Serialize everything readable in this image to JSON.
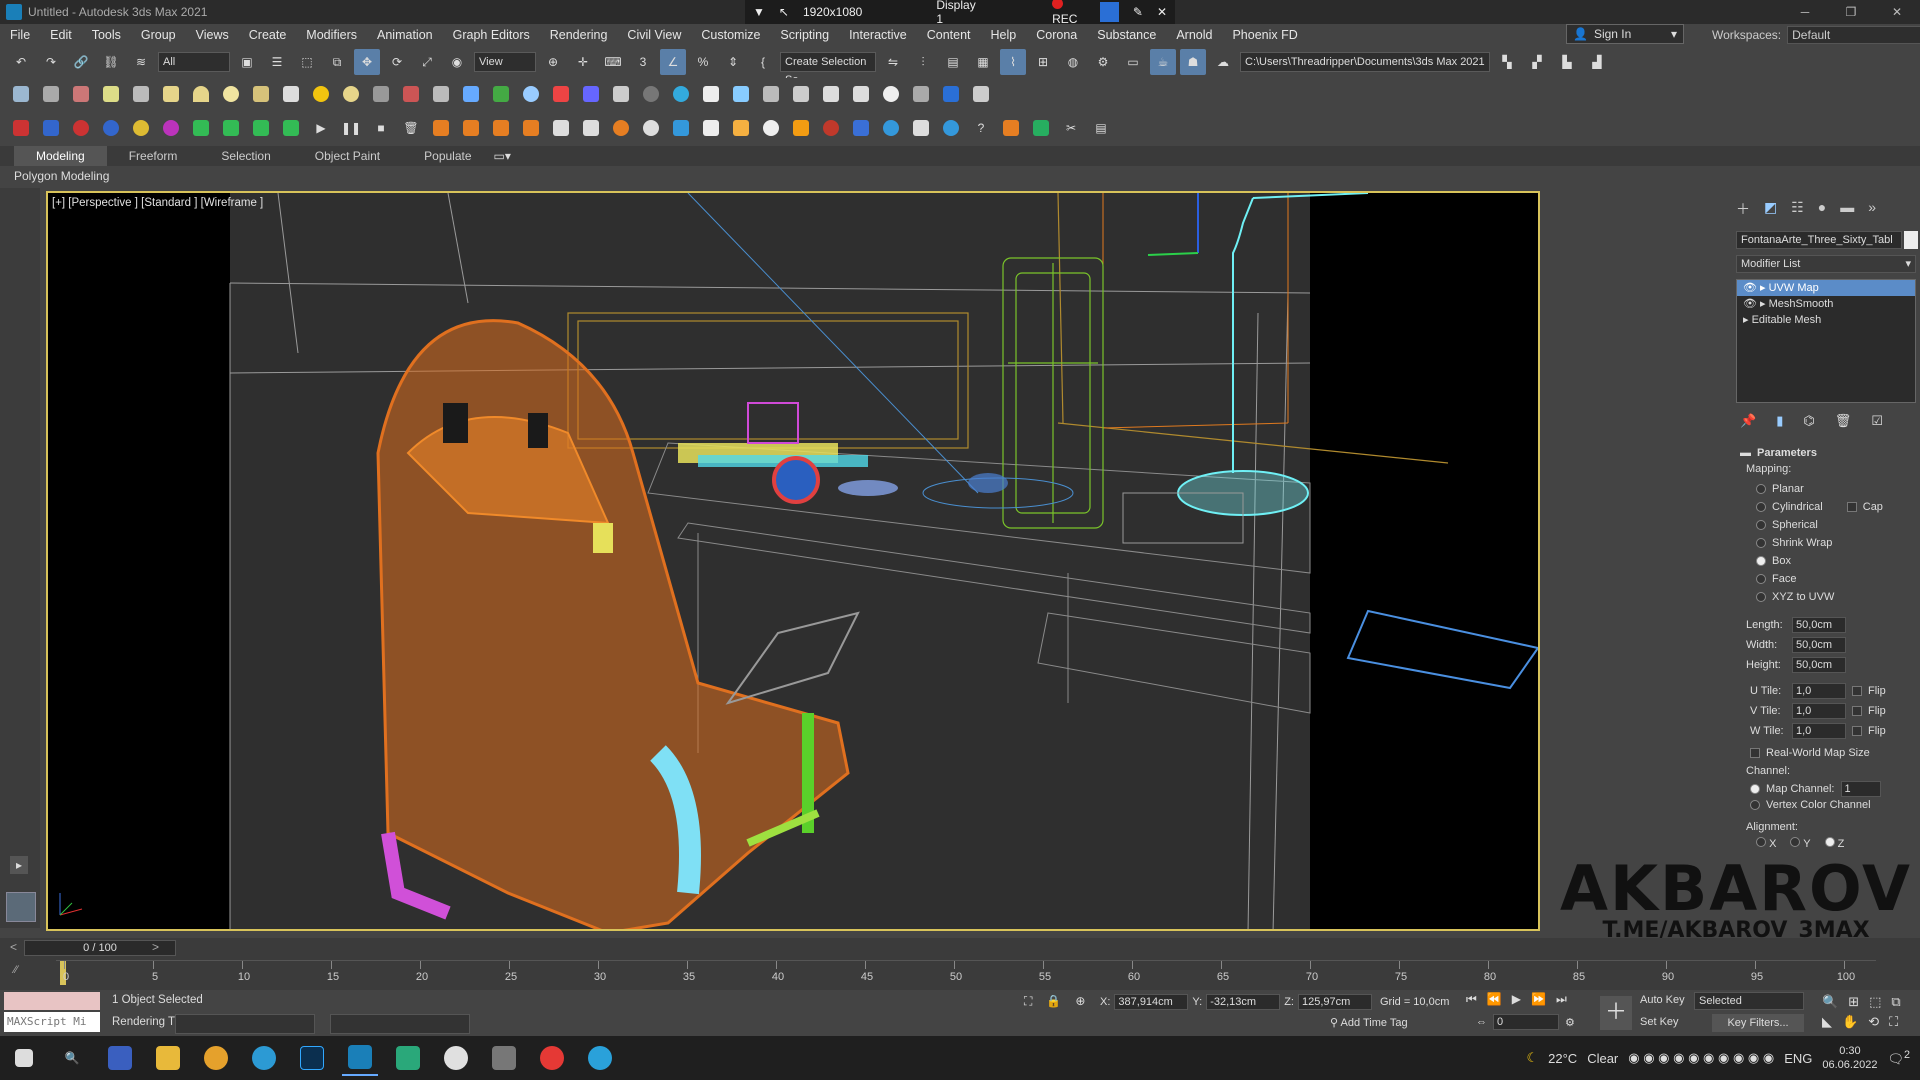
{
  "window": {
    "title": "Untitled - Autodesk 3ds Max 2021"
  },
  "recorder": {
    "resolution": "1920x1080",
    "display": "Display 1",
    "rec_label": "REC"
  },
  "menu": [
    "File",
    "Edit",
    "Tools",
    "Group",
    "Views",
    "Create",
    "Modifiers",
    "Animation",
    "Graph Editors",
    "Rendering",
    "Civil View",
    "Customize",
    "Scripting",
    "Interactive",
    "Content",
    "Help",
    "Corona",
    "Substance",
    "Arnold",
    "Phoenix FD"
  ],
  "account": {
    "sign_in": "Sign In",
    "workspaces_label": "Workspaces:",
    "workspace": "Default"
  },
  "toolbar": {
    "filter": "All",
    "refcoord": "View",
    "selection_set": "Create Selection Se",
    "project_path": "C:\\Users\\Threadripper\\Documents\\3ds Max 2021"
  },
  "ribbon": {
    "tabs": [
      "Modeling",
      "Freeform",
      "Selection",
      "Object Paint",
      "Populate"
    ],
    "sub": "Polygon Modeling"
  },
  "viewport": {
    "label": "[+] [Perspective ] [Standard ] [Wireframe ]"
  },
  "panel": {
    "object_name": "FontanaArte_Three_Sixty_Tabl",
    "modifier_list": "Modifier List",
    "stack": [
      "UVW Map",
      "MeshSmooth",
      "Editable Mesh"
    ],
    "parameters": "Parameters",
    "mapping": "Mapping:",
    "mapping_types": [
      "Planar",
      "Cylindrical",
      "Spherical",
      "Shrink Wrap",
      "Box",
      "Face",
      "XYZ to UVW"
    ],
    "cap": "Cap",
    "length_label": "Length:",
    "length": "50,0cm",
    "width_label": "Width:",
    "width": "50,0cm",
    "height_label": "Height:",
    "height": "50,0cm",
    "utile_label": "U Tile:",
    "utile": "1,0",
    "vtile_label": "V Tile:",
    "vtile": "1,0",
    "wtile_label": "W Tile:",
    "wtile": "1,0",
    "flip": "Flip",
    "real_world": "Real-World Map Size",
    "channel": "Channel:",
    "map_channel": "Map Channel:",
    "map_channel_value": "1",
    "vertex_color": "Vertex Color Channel",
    "alignment": "Alignment:",
    "axes": [
      "X",
      "Y",
      "Z"
    ]
  },
  "watermark": {
    "name": "AKBAROV",
    "link": "T.ME/AKBAROV_3MAX"
  },
  "timeline": {
    "frame": "0 / 100",
    "ticks": [
      "0",
      "5",
      "10",
      "15",
      "20",
      "25",
      "30",
      "35",
      "40",
      "45",
      "50",
      "55",
      "60",
      "65",
      "70",
      "75",
      "80",
      "85",
      "90",
      "95",
      "100"
    ]
  },
  "status": {
    "selected": "1 Object Selected",
    "maxscript": "MAXScript Mi",
    "rendering": "Rendering T",
    "x_label": "X:",
    "x": "387,914cm",
    "y_label": "Y:",
    "y": "-32,13cm",
    "z_label": "Z:",
    "z": "125,97cm",
    "grid": "Grid = 10,0cm",
    "add_time_tag": "Add Time Tag",
    "auto_key": "Auto Key",
    "set_key": "Set Key",
    "key_mode": "Selected",
    "key_filters": "Key Filters...",
    "frame_field": "0"
  },
  "taskbar": {
    "weather_temp": "22°C",
    "weather_text": "Clear",
    "lang": "ENG",
    "time": "0:30",
    "date": "06.06.2022",
    "notif": "2"
  }
}
